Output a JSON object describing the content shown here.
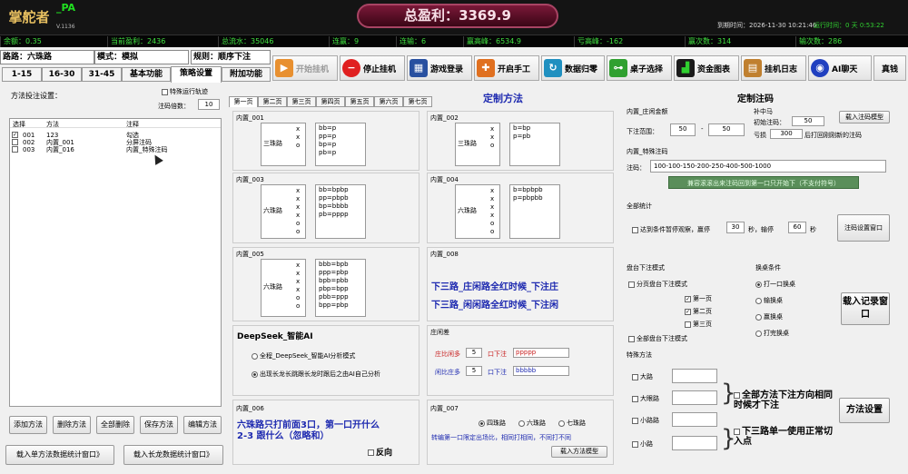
{
  "header": {
    "logo": "掌舵者",
    "app_name": "_PA",
    "version": "V.1136",
    "total_profit_label": "总盈利：",
    "total_profit": "3369.9",
    "datetime": "到期时间：2026-11-30 10:21:46",
    "run_time": "运行时间：0 天 0:53:22"
  },
  "stats": [
    {
      "label": "余额：",
      "value": "0.35"
    },
    {
      "label": "当前盈利：",
      "value": "2436"
    },
    {
      "label": "总流水：",
      "value": "35046"
    },
    {
      "label": "连赢：",
      "value": "9"
    },
    {
      "label": "连输：",
      "value": "6"
    },
    {
      "label": "赢高峰：",
      "value": "6534.9"
    },
    {
      "label": "亏高峰：",
      "value": "-162"
    },
    {
      "label": "赢次数：",
      "value": "314"
    },
    {
      "label": "输次数：",
      "value": "286"
    }
  ],
  "info": {
    "road": "路路：六珠路",
    "mode_label": "模式：",
    "mode": "模拟",
    "rule_label": "规则：",
    "rule": "顺序下注"
  },
  "tabs": [
    "1-15",
    "16-30",
    "31-45",
    "基本功能",
    "策略设置",
    "附加功能"
  ],
  "toolbar": [
    {
      "label": "开始挂机",
      "icon": "play-icon",
      "color": "#e89030"
    },
    {
      "label": "停止挂机",
      "icon": "stop-icon",
      "color": "#e02020"
    },
    {
      "label": "游戏登录",
      "icon": "keyboard-icon",
      "color": "#2850a0"
    },
    {
      "label": "开启手工",
      "icon": "hand-icon",
      "color": "#e07020"
    },
    {
      "label": "数据归零",
      "icon": "refresh-icon",
      "color": "#2090c0"
    },
    {
      "label": "桌子选择",
      "icon": "table-icon",
      "color": "#30a030"
    },
    {
      "label": "资金图表",
      "icon": "chart-icon",
      "color": "#30a030"
    },
    {
      "label": "挂机日志",
      "icon": "log-icon",
      "color": "#c08030"
    },
    {
      "label": "AI聊天",
      "icon": "robot-icon",
      "color": "#2040c0"
    },
    {
      "label": "真钱",
      "icon": "",
      "color": ""
    }
  ],
  "left": {
    "title": "方法投注设置：",
    "special_run": "特殊运行轨迹",
    "multiplier_label": "注码倍数：",
    "multiplier": "10",
    "cols": [
      "选择",
      "方法",
      "注释"
    ],
    "rows": [
      {
        "checked": true,
        "no": "001",
        "method": "123",
        "note": "勾选"
      },
      {
        "checked": false,
        "no": "002",
        "method": "内置_001",
        "note": "分屏注码"
      },
      {
        "checked": false,
        "no": "003",
        "method": "内置_016",
        "note": "内置_特殊注码"
      }
    ],
    "buttons": [
      "添加方法",
      "删除方法",
      "全部删除",
      "保存方法",
      "编辑方法"
    ],
    "load_single": "载入单方法数据统计窗口》",
    "load_long": "载入长龙数据统计窗口》"
  },
  "center": {
    "title": "定制方法",
    "pages": [
      "第一页",
      "第二页",
      "第三页",
      "第四页",
      "第五页",
      "第六页",
      "第七页"
    ],
    "b001": {
      "title": "内置_001",
      "road": "三珠路",
      "pat": "x\nx\no",
      "list": "bb=p\npp=p\nbp=p\npb=p"
    },
    "b002": {
      "title": "内置_002",
      "road": "三珠路",
      "pat": "x\nx\no",
      "list": "b=bp\np=pb"
    },
    "b003": {
      "title": "内置_003",
      "road": "六珠路",
      "pat": "x\nx\nx\nx\no\no",
      "list": "bb=bpbp\npp=pbpb\nbp=bbbb\npb=pppp"
    },
    "b004": {
      "title": "内置_004",
      "road": "六珠路",
      "pat": "x\nx\nx\nx\no\no",
      "list": "b=bpbpb\np=pbpbb"
    },
    "b005": {
      "title": "内置_005",
      "road": "六珠路",
      "pat": "x\nx\nx\nx\no\no",
      "list": "bbb=bpb\nppp=pbp\nbpb=pbb\npbp=bpp\npbb=ppp\nbpp=pbp"
    },
    "b008": {
      "title": "内置_008",
      "line1": "下三路_庄闲路全红时候_下注庄",
      "line2": "下三路_闲闲路全红时候_下注闲"
    },
    "ai": {
      "title": "DeepSeek_智能AI",
      "opt1": "全程_DeepSeek_智能AI分析模式",
      "opt2": "出现长龙长跳跟长龙时跟后之由AI自己分析"
    },
    "zx": {
      "title": "庄闲差",
      "zhuang_label": "庄比闲多",
      "zhuang_val": "5",
      "zhuang_bet": "口下注",
      "zhuang_seq": "ppppp",
      "xian_label": "闲比庄多",
      "xian_val": "5",
      "xian_bet": "口下注",
      "xian_seq": "bbbbb"
    },
    "b006": {
      "title": "内置_006",
      "line1": "六珠路只打前面3口，第一口开什么",
      "line2": "2-3  跟什么（忽略和）",
      "reverse": "反向"
    },
    "b007": {
      "title": "内置_007",
      "r1": "四珠路",
      "r2": "六珠路",
      "r3": "七珠路",
      "desc": "转编第一口限定出场比，相同打相同，不同打不同",
      "load_btn": "载入方法模型"
    }
  },
  "right": {
    "title": "定制注码",
    "builtin_label": "内置_庄闲金额",
    "bet_range_label": "下注范围：",
    "bet_min": "50",
    "bet_max": "50",
    "mid_label": "补中马",
    "init_label": "初始注码：",
    "init_val": "50",
    "lose_label": "亏损",
    "lose_val": "300",
    "lose_after": "后打回刚刚新的注码",
    "load_model": "载入注码模型",
    "special_label": "内置_特殊注码",
    "seq_label": "注码：",
    "seq": "100-100-150-200-250-400-500-1000",
    "green_banner": "兼容滚滚出来注码回到第一口只开始下（不支付符号）",
    "global_label": "全部统计",
    "pause_label": "达到条件暂停观察，赢停",
    "win_stop": "30",
    "win_unit": "秒，输停",
    "lose_stop": "60",
    "lose_unit": "秒",
    "win_window": "注码设置窗口",
    "tables_label": "盘台下注模式",
    "split_label": "分页盘台下注模式",
    "p1": "第一页",
    "p2": "第二页",
    "p3": "第三页",
    "all_tables": "全部盘台下注模式",
    "switch_label": "换桌条件",
    "s1": "打一口换桌",
    "s2": "输换桌",
    "s3": "赢换桌",
    "s4": "打完换桌",
    "load_record": "载入记录窗口",
    "special_method": "特殊方法",
    "m1": "大路",
    "m2": "大眼路",
    "m3": "小路路",
    "m4": "小路",
    "all_methods": "全部方法下注方向相同时候才下注",
    "three_roads": "下三路单一使用正常切入点",
    "method_settings": "方法设置"
  }
}
